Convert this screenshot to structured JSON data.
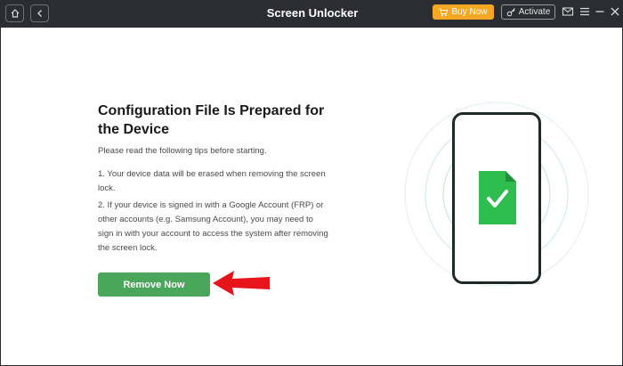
{
  "window": {
    "title": "Screen Unlocker",
    "buy_label": "Buy Now",
    "activate_label": "Activate"
  },
  "main": {
    "heading": "Configuration File Is Prepared for the Device",
    "intro": "Please read the following tips before starting.",
    "tips": [
      "1. Your device data will be erased when removing the screen lock.",
      "2. If your device is signed in with a Google Account (FRP) or other accounts (e.g. Samsung Account), you may need to sign in with your account to access the system after removing the screen lock."
    ],
    "remove_button_label": "Remove Now"
  },
  "colors": {
    "titlebar": "#2b2d33",
    "buy_button": "#f5a623",
    "primary_green": "#4aa65a",
    "annotation_arrow": "#e8141c"
  },
  "icons": {
    "home": "home-icon",
    "back": "back-arrow-icon",
    "cart": "cart-icon",
    "key": "key-icon",
    "mail": "mail-icon",
    "menu": "hamburger-menu-icon",
    "minimize": "minimize-icon",
    "close": "close-icon",
    "phone": "phone-icon",
    "file_check": "file-check-icon"
  }
}
